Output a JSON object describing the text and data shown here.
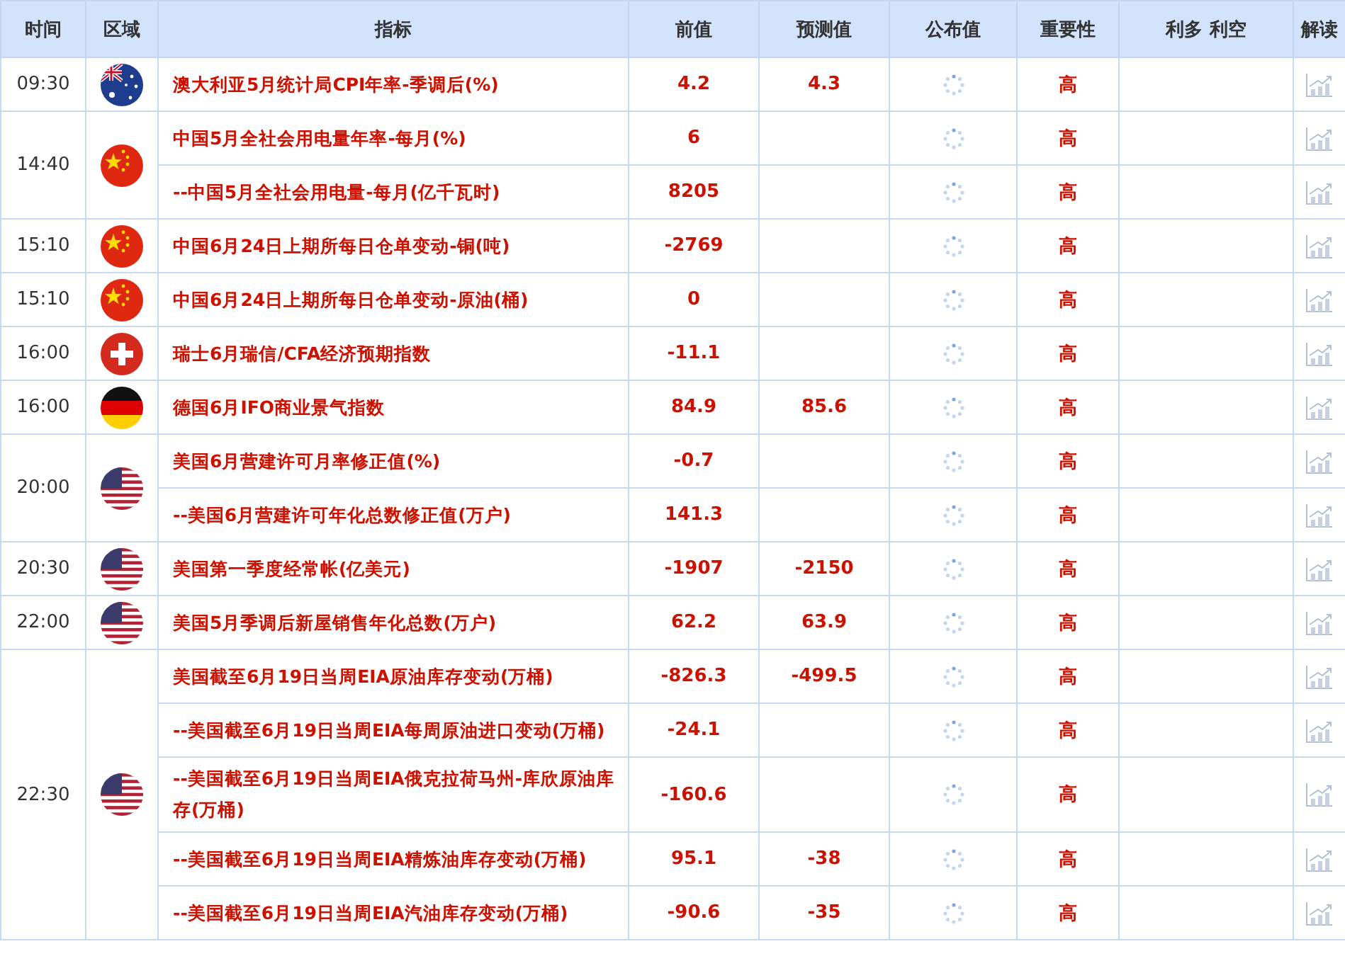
{
  "table": {
    "columns": [
      "时间",
      "区域",
      "指标",
      "前值",
      "预测值",
      "公布值",
      "重要性",
      "利多 利空",
      "解读"
    ],
    "groups": [
      {
        "time": "09:30",
        "kind": "australia",
        "events": [
          {
            "indicator": "澳大利亚5月统计局CPI年率-季调后(%)",
            "previous": "4.2",
            "forecast": "4.3",
            "importance": "高"
          }
        ]
      },
      {
        "time": "14:40",
        "kind": "china",
        "events": [
          {
            "indicator": "中国5月全社会用电量年率-每月(%)",
            "previous": "6",
            "importance": "高"
          },
          {
            "indicator": "--中国5月全社会用电量-每月(亿千瓦时)",
            "previous": "8205",
            "importance": "高"
          }
        ]
      },
      {
        "time": "15:10",
        "kind": "china",
        "events": [
          {
            "indicator": "中国6月24日上期所每日仓单变动-铜(吨)",
            "previous": "-2769",
            "importance": "高"
          }
        ]
      },
      {
        "time": "15:10",
        "kind": "china",
        "events": [
          {
            "indicator": "中国6月24日上期所每日仓单变动-原油(桶)",
            "previous": "0",
            "importance": "高"
          }
        ]
      },
      {
        "time": "16:00",
        "kind": "switzerland",
        "events": [
          {
            "indicator": "瑞士6月瑞信/CFA经济预期指数",
            "previous": "-11.1",
            "importance": "高"
          }
        ]
      },
      {
        "time": "16:00",
        "kind": "germany",
        "events": [
          {
            "indicator": "德国6月IFO商业景气指数",
            "previous": "84.9",
            "forecast": "85.6",
            "importance": "高"
          }
        ]
      },
      {
        "time": "20:00",
        "kind": "usa",
        "events": [
          {
            "indicator": "美国6月营建许可月率修正值(%)",
            "previous": "-0.7",
            "importance": "高"
          },
          {
            "indicator": "--美国6月营建许可年化总数修正值(万户)",
            "previous": "141.3",
            "importance": "高"
          }
        ]
      },
      {
        "time": "20:30",
        "kind": "usa",
        "events": [
          {
            "indicator": "美国第一季度经常帐(亿美元)",
            "previous": "-1907",
            "forecast": "-2150",
            "importance": "高"
          }
        ]
      },
      {
        "time": "22:00",
        "kind": "usa",
        "events": [
          {
            "indicator": "美国5月季调后新屋销售年化总数(万户)",
            "previous": "62.2",
            "forecast": "63.9",
            "importance": "高"
          }
        ]
      },
      {
        "time": "22:30",
        "kind": "usa",
        "events": [
          {
            "indicator": "美国截至6月19日当周EIA原油库存变动(万桶)",
            "previous": "-826.3",
            "forecast": "-499.5",
            "importance": "高"
          },
          {
            "indicator": "--美国截至6月19日当周EIA每周原油进口变动(万桶)",
            "previous": "-24.1",
            "importance": "高"
          },
          {
            "indicator": "--美国截至6月19日当周EIA俄克拉荷马州-库欣原油库存(万桶)",
            "previous": "-160.6",
            "importance": "高"
          },
          {
            "indicator": "--美国截至6月19日当周EIA精炼油库存变动(万桶)",
            "previous": "95.1",
            "forecast": "-38",
            "importance": "高"
          },
          {
            "indicator": "--美国截至6月19日当周EIA汽油库存变动(万桶)",
            "previous": "-90.6",
            "forecast": "-35",
            "importance": "高"
          }
        ]
      }
    ]
  }
}
